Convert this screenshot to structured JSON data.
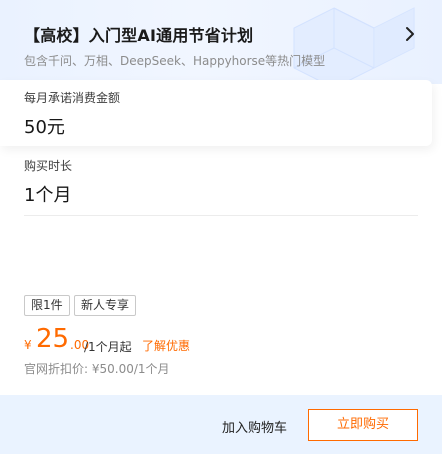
{
  "plan": {
    "title": "【高校】入门型AI通用节省计划",
    "subtitle": "包含千问、万相、DeepSeek、Happyhorse等热门模型"
  },
  "fields": {
    "commitment_label": "每月承诺消费金额",
    "commitment_value": "50元",
    "duration_label": "购买时长",
    "duration_value": "1个月"
  },
  "tags": [
    "限1件",
    "新人专享"
  ],
  "price": {
    "currency": "¥",
    "integer": "25",
    "decimal": ".00",
    "unit": "/1个月起",
    "discount_link": "了解优惠",
    "original": "官网折扣价: ¥50.00/1个月"
  },
  "actions": {
    "cart_label": "加入购物车",
    "buy_label": "立即购买"
  },
  "colors": {
    "accent": "#ff6a00",
    "header_bg": "#eaf2ff",
    "footer_bg": "#eaf3ff"
  },
  "icons": {
    "header_action": "chevron-right-icon",
    "header_decoration": "isometric-cube-decoration"
  }
}
